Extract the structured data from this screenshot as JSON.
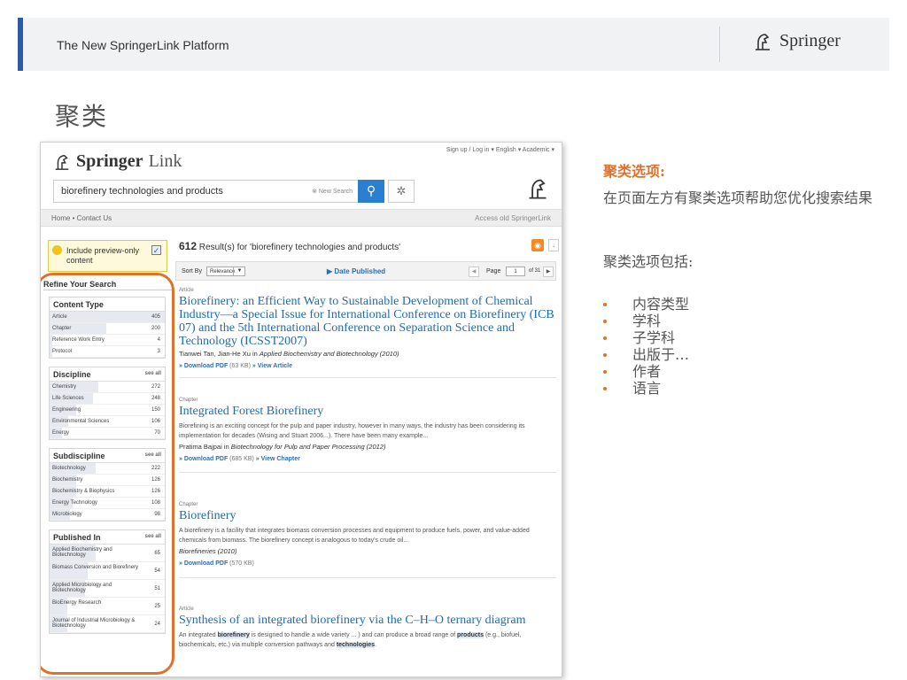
{
  "slide": {
    "header_title": "The New SpringerLink Platform",
    "logo_text": "Springer",
    "heading": "聚类"
  },
  "springerlink": {
    "logo_text": "Springer",
    "logo_link": "Link",
    "account_bar": "Sign up / Log in  ▾   English  ▾   Academic  ▾",
    "search_value": "biorefinery technologies and products",
    "new_search": "⊗ New Search",
    "nav_home": "Home  •  Contact Us",
    "nav_old": "Access old SpringerLink",
    "preview_label": "Include preview-only content",
    "refine_title": "Refine Your Search",
    "filters": [
      {
        "title": "Content Type",
        "see_all": "",
        "rows": [
          {
            "label": "Article",
            "count": "405",
            "bar": 1.0
          },
          {
            "label": "Chapter",
            "count": "200",
            "bar": 0.49
          },
          {
            "label": "Reference Work Entry",
            "count": "4",
            "bar": 0.02
          },
          {
            "label": "Protocol",
            "count": "3",
            "bar": 0.02
          }
        ]
      },
      {
        "title": "Discipline",
        "see_all": "see all",
        "rows": [
          {
            "label": "Chemistry",
            "count": "272",
            "bar": 0.42
          },
          {
            "label": "Life Sciences",
            "count": "248",
            "bar": 0.38
          },
          {
            "label": "Engineering",
            "count": "150",
            "bar": 0.23
          },
          {
            "label": "Environmental Sciences",
            "count": "106",
            "bar": 0.16
          },
          {
            "label": "Energy",
            "count": "70",
            "bar": 0.11
          }
        ]
      },
      {
        "title": "Subdiscipline",
        "see_all": "see all",
        "rows": [
          {
            "label": "Biotechnology",
            "count": "222",
            "bar": 0.4
          },
          {
            "label": "Biochemistry",
            "count": "126",
            "bar": 0.23
          },
          {
            "label": "Biochemistry & Biophysics",
            "count": "126",
            "bar": 0.23
          },
          {
            "label": "Energy Technology",
            "count": "108",
            "bar": 0.2
          },
          {
            "label": "Microbiology",
            "count": "98",
            "bar": 0.18
          }
        ]
      },
      {
        "title": "Published In",
        "see_all": "see all",
        "rows": [
          {
            "label": "Applied Biochemistry and Biotechnology",
            "count": "65",
            "bar": 0.4
          },
          {
            "label": "Biomass Conversion and Biorefinery",
            "count": "54",
            "bar": 0.33
          },
          {
            "label": "Applied Microbiology and Biotechnology",
            "count": "51",
            "bar": 0.31
          },
          {
            "label": "BioEnergy Research",
            "count": "25",
            "bar": 0.15
          },
          {
            "label": "Journal of Industrial Microbiology & Biotechnology",
            "count": "24",
            "bar": 0.15
          }
        ]
      }
    ],
    "result_count": "612",
    "result_text": " Result(s) for 'biorefinery technologies and products'",
    "sort_by": "Sort By",
    "sort_value": "Relevance",
    "date_published": "▶  Date Published",
    "page_label": "Page",
    "page_value": "1",
    "page_of": "of 31",
    "results": [
      {
        "type": "Article",
        "title": "Biorefinery: an Efficient Way to Sustainable Development of Chemical Industry—a Special Issue for International Conference on Biorefinery (ICB 07) and the 5th International Conference on Separation Science and Technology (ICSST2007)",
        "desc": "",
        "authors": "Tianwei Tan, Jian-He Xu in ",
        "source": "Applied Biochemistry and Biotechnology (2010)",
        "link1": "» Download PDF",
        "size": " (63 KB)",
        "link2": "  » View Article"
      },
      {
        "type": "Chapter",
        "title": "Integrated Forest Biorefinery",
        "desc": "Biorefining is an exciting concept for the pulp and paper industry, however in many ways, the industry has been considering its implementation for decades (Wising and Stuart 2006...). There have been many example...",
        "authors": "Pratima Bajpai in ",
        "source": "Biotechnology for Pulp and Paper Processing (2012)",
        "link1": "» Download PDF",
        "size": " (685 KB)",
        "link2": "  » View Chapter"
      },
      {
        "type": "Chapter",
        "title": "Biorefinery",
        "desc": "A biorefinery is a facility that integrates biomass conversion processes and equipment to produce fuels, power, and value-added chemicals from biomass. The biorefinery concept is analogous to today's crude oil...",
        "authors": "",
        "source": "Biorefineries (2010)",
        "link1": "» Download PDF",
        "size": " (570 KB)",
        "link2": ""
      },
      {
        "type": "Article",
        "title": "Synthesis of an integrated biorefinery via the C–H–O ternary diagram",
        "desc_parts": [
          "An integrated ",
          "biorefinery",
          " is designed to handle a wide variety ... ) and can produce a broad range of ",
          "products",
          " (e.g., biofuel, biochemicals, etc.) via multiple conversion pathways and ",
          "technologies",
          "."
        ]
      }
    ]
  },
  "right_panel": {
    "heading": "聚类选项:",
    "intro": "在页面左方有聚类选项帮助您优化搜索结果",
    "list_title": "聚类选项包括:",
    "items": [
      "内容类型",
      "学科",
      "子学科",
      "出版于…",
      "作者",
      "语言"
    ]
  },
  "colors": {
    "accent_blue": "#2b5aa6",
    "highlight_orange": "#e0712b",
    "link_blue": "#1f6bb3"
  }
}
